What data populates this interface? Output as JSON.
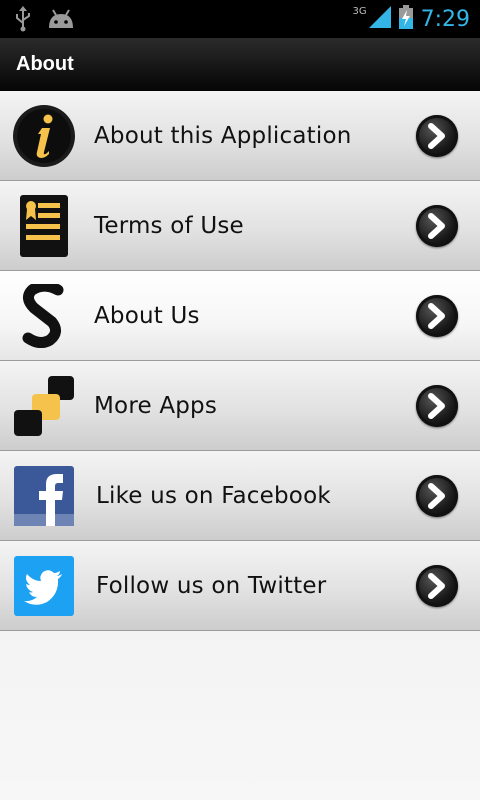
{
  "status_bar": {
    "network": "3G",
    "time": "7:29",
    "icons": [
      "usb-icon",
      "android-icon",
      "signal-icon",
      "battery-charging-icon"
    ]
  },
  "action_bar": {
    "title": "About"
  },
  "menu": {
    "items": [
      {
        "label": "About this Application",
        "icon": "info-icon"
      },
      {
        "label": "Terms of Use",
        "icon": "document-icon"
      },
      {
        "label": "About Us",
        "icon": "logo-icon"
      },
      {
        "label": "More Apps",
        "icon": "apps-icon"
      },
      {
        "label": "Like us on Facebook",
        "icon": "facebook-icon"
      },
      {
        "label": "Follow us on Twitter",
        "icon": "twitter-icon"
      }
    ],
    "chevron_icon": "chevron-right-icon"
  },
  "colors": {
    "accent": "#33b5e5",
    "facebook": "#3b5998",
    "twitter": "#1da1f2",
    "gold": "#f5c24b"
  }
}
